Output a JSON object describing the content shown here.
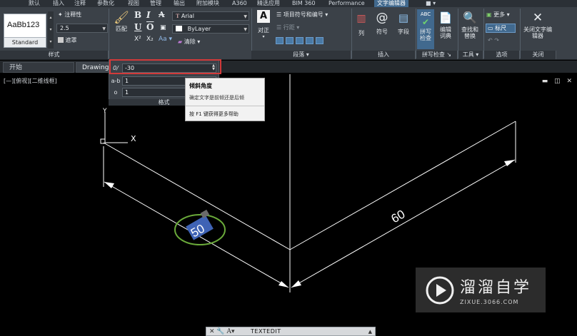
{
  "ribbon_tabs": [
    {
      "label": "默认"
    },
    {
      "label": "插入"
    },
    {
      "label": "注释"
    },
    {
      "label": "参数化"
    },
    {
      "label": "视图"
    },
    {
      "label": "管理"
    },
    {
      "label": "输出"
    },
    {
      "label": "附加模块"
    },
    {
      "label": "A360"
    },
    {
      "label": "精选应用"
    },
    {
      "label": "BIM 360"
    },
    {
      "label": "Performance"
    },
    {
      "label": "文字编辑器"
    }
  ],
  "style_panel": {
    "preview_text": "AaBb123",
    "standard_label": "Standard",
    "annotative_label": "注释性",
    "height_value": "2.5",
    "mask_label": "遮罩",
    "panel_label": "样式"
  },
  "format_panel": {
    "match_label": "匹配",
    "font_value": "Arial",
    "color_value": "ByLayer",
    "clear_label": "清除",
    "bold": "B",
    "italic": "I",
    "strike": "A",
    "underline": "U",
    "overline": "O",
    "superscript": "X²",
    "subscript": "X₂",
    "case": "Aa"
  },
  "paragraph_panel": {
    "justify_label": "对正",
    "bullets_label": "项目符号和编号",
    "line_spacing_label": "行距",
    "panel_label": "段落"
  },
  "insert_panel": {
    "columns_label": "列",
    "symbol_label": "符号",
    "field_label": "字段",
    "panel_label": "插入"
  },
  "spell_panel": {
    "spell_check_label": "拼写检查",
    "edit_dict_label": "编辑词典",
    "panel_label": "拼写检查"
  },
  "tools_panel": {
    "find_replace_label": "查找和替换",
    "panel_label": "工具"
  },
  "options_panel": {
    "more_label": "更多",
    "ruler_label": "标尺",
    "panel_label": "选项"
  },
  "close_panel": {
    "close_editor_label": "关闭文字编辑器",
    "panel_label": "关闭"
  },
  "doc_tabs": [
    {
      "label": "开始"
    },
    {
      "label": "Drawing"
    }
  ],
  "format_dropdown": {
    "oblique_icon": "0/",
    "oblique_value": "-30",
    "tracking_icon": "a-b",
    "tracking_value": "1",
    "width_icon": "o",
    "width_value": "1",
    "footer_label": "格式"
  },
  "tooltip": {
    "title": "倾斜角度",
    "description": "确定文字是前倾还是后倾",
    "help": "按 F1 键获得更多帮助"
  },
  "viewport": {
    "label": "[—][俯视][二维线框]",
    "dim_60": "60",
    "dim_50": "50",
    "axis_y": "Y",
    "axis_x": "X"
  },
  "watermark": {
    "title": "溜溜自学",
    "url": "ZIXUE.3066.COM"
  },
  "command_line": {
    "command": "TEXTEDIT"
  },
  "colors": {
    "ribbon_bg": "#3b4148",
    "active_tab": "#41698e",
    "highlight_red": "#d23a3a",
    "ellipse_green": "#6aaa3a",
    "dim_white": "#ffffff",
    "selected_text_blue": "#3f63b5"
  }
}
